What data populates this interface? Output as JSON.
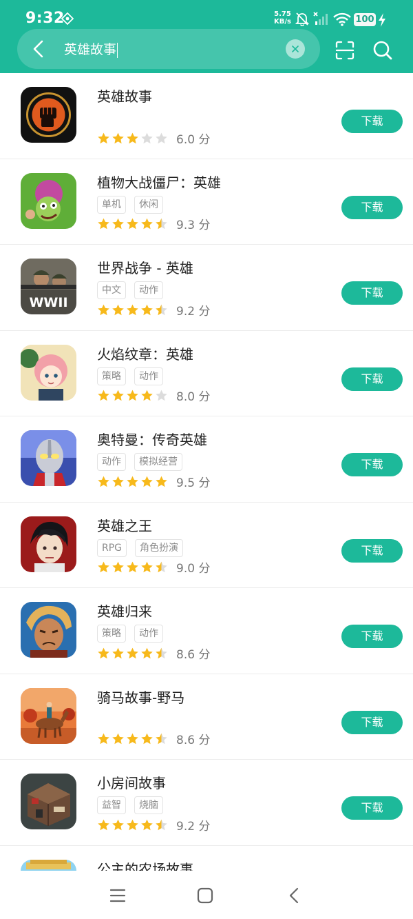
{
  "status_bar": {
    "time": "9:32",
    "net_speed_value": "5.75",
    "net_speed_unit": "KB/s",
    "battery": "100"
  },
  "search": {
    "query": "英雄故事"
  },
  "colors": {
    "accent": "#1db99a",
    "star_on": "#f7b91b",
    "star_off": "#dcdcdc"
  },
  "download_label": "下载",
  "apps": [
    {
      "name": "英雄故事",
      "tags": [],
      "stars": 3,
      "rating": "6.0 分",
      "icon": "fist-emblem"
    },
    {
      "name": "植物大战僵尸：英雄",
      "tags": [
        "单机",
        "休闲"
      ],
      "stars": 4.5,
      "rating": "9.3 分",
      "icon": "zombie-character"
    },
    {
      "name": "世界战争 - 英雄",
      "tags": [
        "中文",
        "动作"
      ],
      "stars": 4.5,
      "rating": "9.2 分",
      "icon": "wwii-soldiers"
    },
    {
      "name": "火焰纹章：英雄",
      "tags": [
        "策略",
        "动作"
      ],
      "stars": 4,
      "rating": "8.0 分",
      "icon": "anime-hero"
    },
    {
      "name": "奥特曼：传奇英雄",
      "tags": [
        "动作",
        "模拟经营"
      ],
      "stars": 5,
      "rating": "9.5 分",
      "icon": "ultraman"
    },
    {
      "name": "英雄之王",
      "tags": [
        "RPG",
        "角色扮演"
      ],
      "stars": 4.5,
      "rating": "9.0 分",
      "icon": "dark-hair-hero"
    },
    {
      "name": "英雄归来",
      "tags": [
        "策略",
        "动作"
      ],
      "stars": 4.5,
      "rating": "8.6 分",
      "icon": "warrior-face"
    },
    {
      "name": "骑马故事-野马",
      "tags": [],
      "stars": 4.5,
      "rating": "8.6 分",
      "icon": "horse-rider"
    },
    {
      "name": "小房间故事",
      "tags": [
        "益智",
        "烧脑"
      ],
      "stars": 4.5,
      "rating": "9.2 分",
      "icon": "tiny-room"
    }
  ],
  "partial_app": {
    "name": "公主的农场故事",
    "icon": "pixel-farm"
  }
}
